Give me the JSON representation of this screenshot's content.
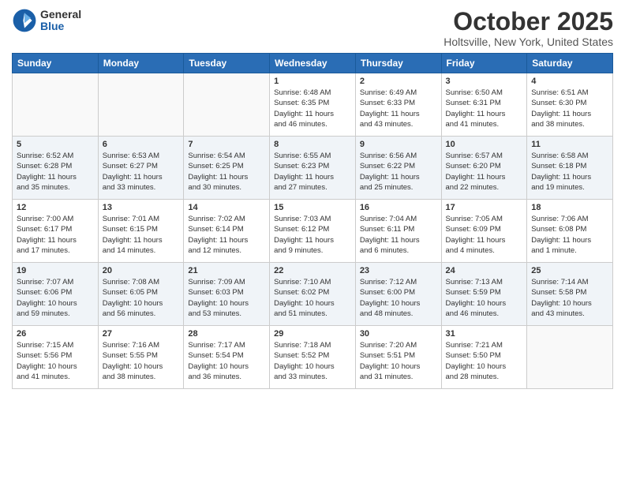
{
  "logo": {
    "general": "General",
    "blue": "Blue"
  },
  "title": "October 2025",
  "location": "Holtsville, New York, United States",
  "headers": [
    "Sunday",
    "Monday",
    "Tuesday",
    "Wednesday",
    "Thursday",
    "Friday",
    "Saturday"
  ],
  "weeks": [
    [
      {
        "day": "",
        "info": ""
      },
      {
        "day": "",
        "info": ""
      },
      {
        "day": "",
        "info": ""
      },
      {
        "day": "1",
        "info": "Sunrise: 6:48 AM\nSunset: 6:35 PM\nDaylight: 11 hours\nand 46 minutes."
      },
      {
        "day": "2",
        "info": "Sunrise: 6:49 AM\nSunset: 6:33 PM\nDaylight: 11 hours\nand 43 minutes."
      },
      {
        "day": "3",
        "info": "Sunrise: 6:50 AM\nSunset: 6:31 PM\nDaylight: 11 hours\nand 41 minutes."
      },
      {
        "day": "4",
        "info": "Sunrise: 6:51 AM\nSunset: 6:30 PM\nDaylight: 11 hours\nand 38 minutes."
      }
    ],
    [
      {
        "day": "5",
        "info": "Sunrise: 6:52 AM\nSunset: 6:28 PM\nDaylight: 11 hours\nand 35 minutes."
      },
      {
        "day": "6",
        "info": "Sunrise: 6:53 AM\nSunset: 6:27 PM\nDaylight: 11 hours\nand 33 minutes."
      },
      {
        "day": "7",
        "info": "Sunrise: 6:54 AM\nSunset: 6:25 PM\nDaylight: 11 hours\nand 30 minutes."
      },
      {
        "day": "8",
        "info": "Sunrise: 6:55 AM\nSunset: 6:23 PM\nDaylight: 11 hours\nand 27 minutes."
      },
      {
        "day": "9",
        "info": "Sunrise: 6:56 AM\nSunset: 6:22 PM\nDaylight: 11 hours\nand 25 minutes."
      },
      {
        "day": "10",
        "info": "Sunrise: 6:57 AM\nSunset: 6:20 PM\nDaylight: 11 hours\nand 22 minutes."
      },
      {
        "day": "11",
        "info": "Sunrise: 6:58 AM\nSunset: 6:18 PM\nDaylight: 11 hours\nand 19 minutes."
      }
    ],
    [
      {
        "day": "12",
        "info": "Sunrise: 7:00 AM\nSunset: 6:17 PM\nDaylight: 11 hours\nand 17 minutes."
      },
      {
        "day": "13",
        "info": "Sunrise: 7:01 AM\nSunset: 6:15 PM\nDaylight: 11 hours\nand 14 minutes."
      },
      {
        "day": "14",
        "info": "Sunrise: 7:02 AM\nSunset: 6:14 PM\nDaylight: 11 hours\nand 12 minutes."
      },
      {
        "day": "15",
        "info": "Sunrise: 7:03 AM\nSunset: 6:12 PM\nDaylight: 11 hours\nand 9 minutes."
      },
      {
        "day": "16",
        "info": "Sunrise: 7:04 AM\nSunset: 6:11 PM\nDaylight: 11 hours\nand 6 minutes."
      },
      {
        "day": "17",
        "info": "Sunrise: 7:05 AM\nSunset: 6:09 PM\nDaylight: 11 hours\nand 4 minutes."
      },
      {
        "day": "18",
        "info": "Sunrise: 7:06 AM\nSunset: 6:08 PM\nDaylight: 11 hours\nand 1 minute."
      }
    ],
    [
      {
        "day": "19",
        "info": "Sunrise: 7:07 AM\nSunset: 6:06 PM\nDaylight: 10 hours\nand 59 minutes."
      },
      {
        "day": "20",
        "info": "Sunrise: 7:08 AM\nSunset: 6:05 PM\nDaylight: 10 hours\nand 56 minutes."
      },
      {
        "day": "21",
        "info": "Sunrise: 7:09 AM\nSunset: 6:03 PM\nDaylight: 10 hours\nand 53 minutes."
      },
      {
        "day": "22",
        "info": "Sunrise: 7:10 AM\nSunset: 6:02 PM\nDaylight: 10 hours\nand 51 minutes."
      },
      {
        "day": "23",
        "info": "Sunrise: 7:12 AM\nSunset: 6:00 PM\nDaylight: 10 hours\nand 48 minutes."
      },
      {
        "day": "24",
        "info": "Sunrise: 7:13 AM\nSunset: 5:59 PM\nDaylight: 10 hours\nand 46 minutes."
      },
      {
        "day": "25",
        "info": "Sunrise: 7:14 AM\nSunset: 5:58 PM\nDaylight: 10 hours\nand 43 minutes."
      }
    ],
    [
      {
        "day": "26",
        "info": "Sunrise: 7:15 AM\nSunset: 5:56 PM\nDaylight: 10 hours\nand 41 minutes."
      },
      {
        "day": "27",
        "info": "Sunrise: 7:16 AM\nSunset: 5:55 PM\nDaylight: 10 hours\nand 38 minutes."
      },
      {
        "day": "28",
        "info": "Sunrise: 7:17 AM\nSunset: 5:54 PM\nDaylight: 10 hours\nand 36 minutes."
      },
      {
        "day": "29",
        "info": "Sunrise: 7:18 AM\nSunset: 5:52 PM\nDaylight: 10 hours\nand 33 minutes."
      },
      {
        "day": "30",
        "info": "Sunrise: 7:20 AM\nSunset: 5:51 PM\nDaylight: 10 hours\nand 31 minutes."
      },
      {
        "day": "31",
        "info": "Sunrise: 7:21 AM\nSunset: 5:50 PM\nDaylight: 10 hours\nand 28 minutes."
      },
      {
        "day": "",
        "info": ""
      }
    ]
  ]
}
